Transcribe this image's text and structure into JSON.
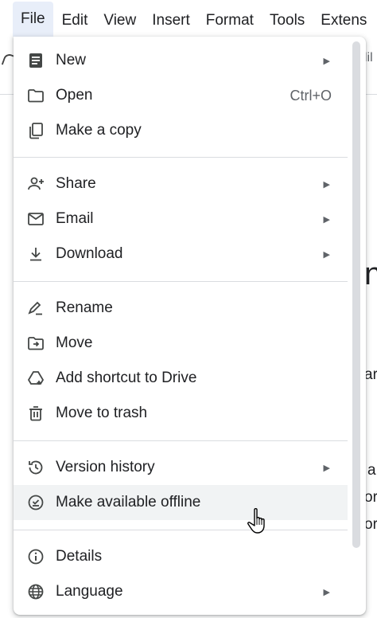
{
  "menubar": {
    "items": [
      {
        "label": "File",
        "active": true
      },
      {
        "label": "Edit"
      },
      {
        "label": "View"
      },
      {
        "label": "Insert"
      },
      {
        "label": "Format"
      },
      {
        "label": "Tools"
      },
      {
        "label": "Extens"
      }
    ]
  },
  "background": {
    "frag_lib": "lil",
    "frag_n": "n",
    "frag_ar": "ar",
    "frag_a": "a",
    "frag_or1": "or",
    "frag_or2": "or"
  },
  "menu": {
    "items": [
      {
        "label": "New",
        "icon": "doc-icon",
        "arrow": "▶"
      },
      {
        "label": "Open",
        "icon": "folder-icon",
        "shortcut": "Ctrl+O"
      },
      {
        "label": "Make a copy",
        "icon": "copy-icon"
      },
      {
        "label": "Share",
        "icon": "person-add-icon",
        "arrow": "▶"
      },
      {
        "label": "Email",
        "icon": "mail-icon",
        "arrow": "▶"
      },
      {
        "label": "Download",
        "icon": "download-icon",
        "arrow": "▶"
      },
      {
        "label": "Rename",
        "icon": "rename-pencil-icon"
      },
      {
        "label": "Move",
        "icon": "move-folder-icon"
      },
      {
        "label": "Add shortcut to Drive",
        "icon": "drive-shortcut-icon"
      },
      {
        "label": "Move to trash",
        "icon": "trash-icon"
      },
      {
        "label": "Version history",
        "icon": "history-icon",
        "arrow": "▶"
      },
      {
        "label": "Make available offline",
        "icon": "offline-check-icon",
        "highlighted": true
      },
      {
        "label": "Details",
        "icon": "info-icon"
      },
      {
        "label": "Language",
        "icon": "globe-icon",
        "arrow": "▶"
      }
    ]
  },
  "colors": {
    "active_menu_bg": "#e8eef9",
    "highlight_bg": "#f1f3f4",
    "icon": "#444746",
    "divider": "#dadce0"
  }
}
